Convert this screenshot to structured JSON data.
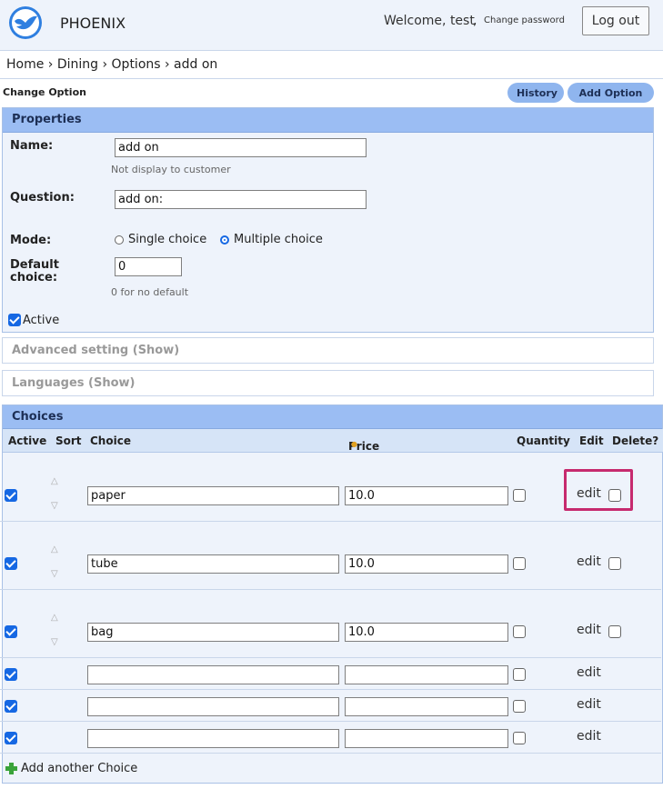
{
  "header": {
    "brand": "PHOENIX",
    "welcome": "Welcome, test",
    "change_password": "Change password",
    "logout_label": "Log out"
  },
  "breadcrumb": "Home › Dining › Options › add on",
  "page_title": "Change Option",
  "buttons": {
    "history": "History",
    "add_option": "Add Option"
  },
  "properties": {
    "title": "Properties",
    "name_label": "Name:",
    "name_value": "add on",
    "name_hint": "Not display to customer",
    "question_label": "Question:",
    "question_value": "add on:",
    "mode_label": "Mode:",
    "mode_single": "Single choice",
    "mode_multiple": "Multiple choice",
    "default_label": "Default choice:",
    "default_value": "0",
    "default_hint": "0 for no default",
    "active_label": "Active"
  },
  "advanced_label": "Advanced setting (Show)",
  "languages_label": "Languages (Show)",
  "choices": {
    "title": "Choices",
    "columns": [
      "Active",
      "Sort",
      "Choice",
      "Price",
      "Quantity",
      "Edit",
      "Delete?"
    ],
    "rows": [
      {
        "choice": "paper",
        "price": "10.0",
        "edit": "edit"
      },
      {
        "choice": "tube",
        "price": "10.0",
        "edit": "edit"
      },
      {
        "choice": "bag",
        "price": "10.0",
        "edit": "edit"
      },
      {
        "choice": "",
        "price": "",
        "edit": "edit"
      },
      {
        "choice": "",
        "price": "",
        "edit": "edit"
      },
      {
        "choice": "",
        "price": "",
        "edit": "edit"
      }
    ],
    "add_another": "Add another Choice"
  },
  "colors": {
    "accent": "#1668e3",
    "header_bar": "#9bbdf3",
    "highlight": "#c62a6e"
  }
}
